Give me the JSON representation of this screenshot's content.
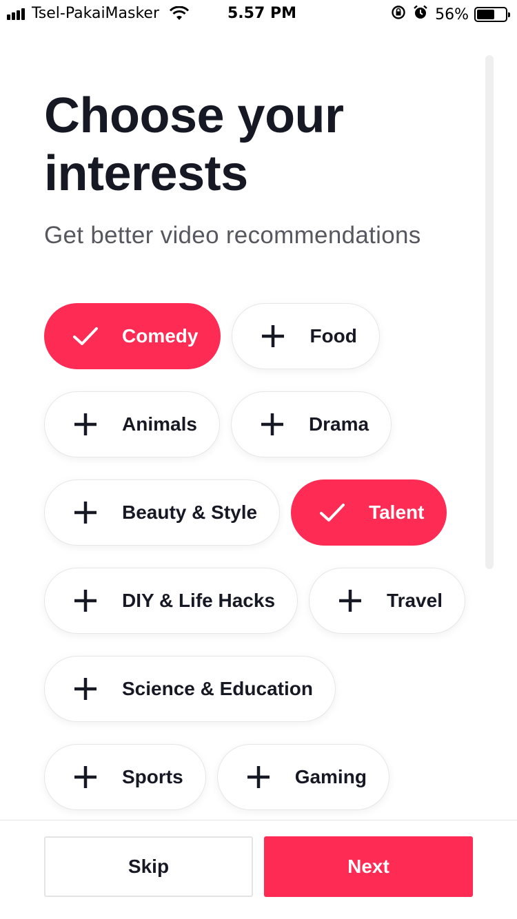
{
  "status_bar": {
    "carrier": "Tsel-PakaiMasker",
    "time": "5.57 PM",
    "battery_percent": "56%",
    "battery_level": 0.56,
    "icons": [
      "signal-icon",
      "wifi-icon",
      "rotation-lock-icon",
      "alarm-icon",
      "battery-icon"
    ]
  },
  "page": {
    "title": "Choose your interests",
    "subtitle": "Get better video recommendations"
  },
  "interests": [
    {
      "label": "Comedy",
      "selected": true
    },
    {
      "label": "Food",
      "selected": false
    },
    {
      "label": "Animals",
      "selected": false
    },
    {
      "label": "Drama",
      "selected": false
    },
    {
      "label": "Beauty & Style",
      "selected": false
    },
    {
      "label": "Talent",
      "selected": true
    },
    {
      "label": "DIY & Life Hacks",
      "selected": false
    },
    {
      "label": "Travel",
      "selected": false
    },
    {
      "label": "Science & Education",
      "selected": false
    },
    {
      "label": "Sports",
      "selected": false
    },
    {
      "label": "Gaming",
      "selected": false
    }
  ],
  "footer": {
    "skip_label": "Skip",
    "next_label": "Next"
  },
  "colors": {
    "accent": "#fe2c55",
    "text": "#161823",
    "subtitle": "#57575f"
  }
}
